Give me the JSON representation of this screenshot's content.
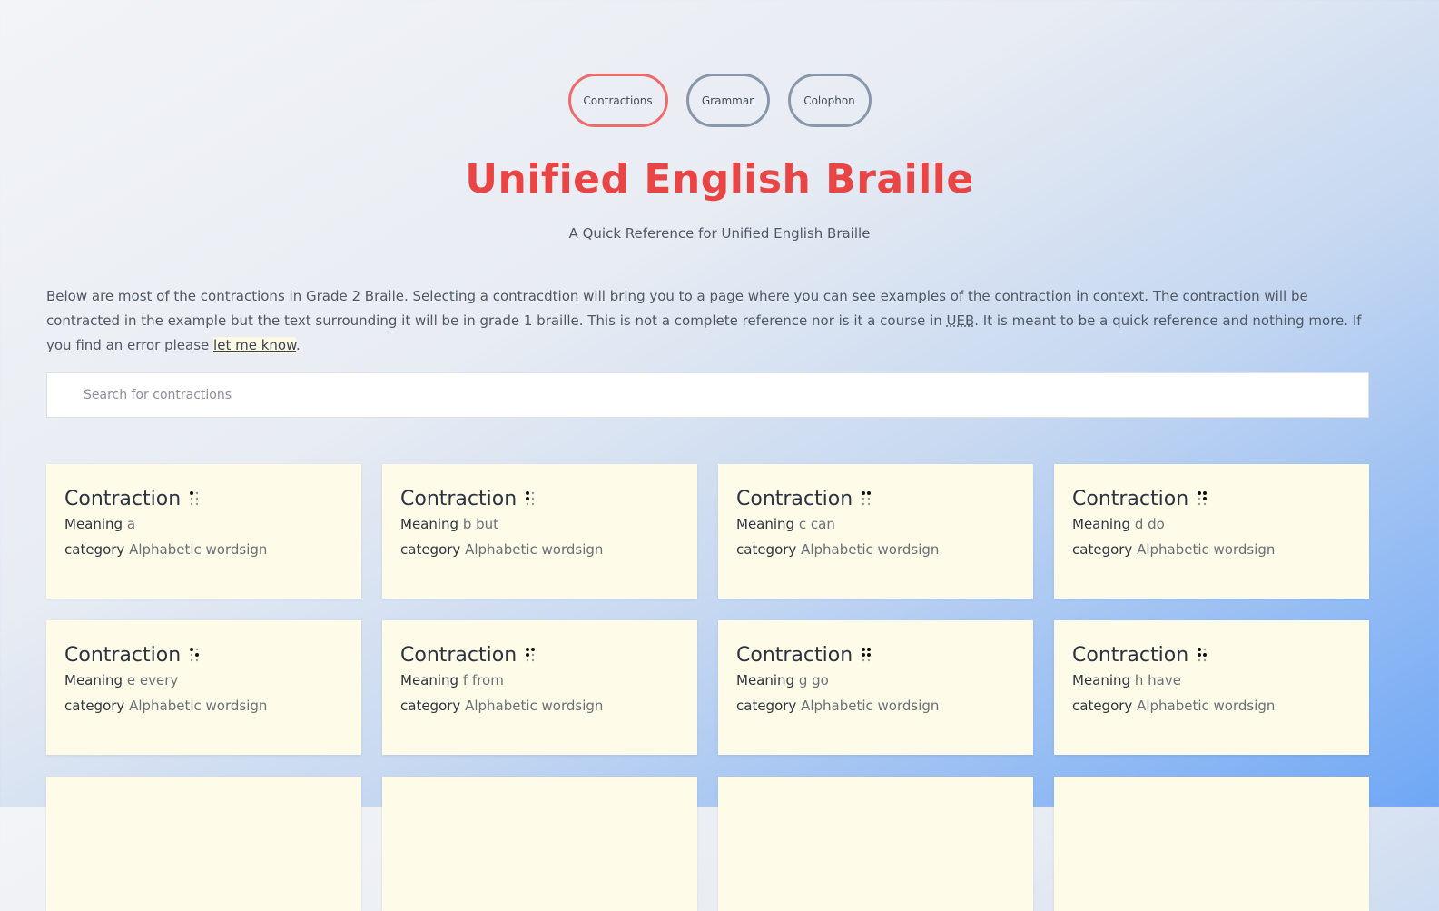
{
  "nav": [
    {
      "label": "Contractions",
      "active": true
    },
    {
      "label": "Grammar",
      "active": false
    },
    {
      "label": "Colophon",
      "active": false
    }
  ],
  "title": "Unified English Braille",
  "subtitle": "A Quick Reference for Unified English Braille",
  "intro": {
    "text1": "Below are most of the contractions in Grade 2 Braile. Selecting a contracdtion will bring you to a page where you can see examples of the contraction in context. The contraction will be contracted in the example but the text surrounding it will be in grade 1 braille. This is not a complete reference nor is it a course in ",
    "abbr": "UEB",
    "text2": ". It is meant to be a quick reference and nothing more. If you find an error please ",
    "link": "let me know",
    "text3": "."
  },
  "search": {
    "placeholder": "Search for contractions"
  },
  "card_labels": {
    "contraction": "Contraction",
    "meaning": "Meaning",
    "category": "category"
  },
  "cards": [
    {
      "braille": "⠁",
      "meaning": "a",
      "category": "Alphabetic wordsign"
    },
    {
      "braille": "⠃",
      "meaning": "b but",
      "category": "Alphabetic wordsign"
    },
    {
      "braille": "⠉",
      "meaning": "c can",
      "category": "Alphabetic wordsign"
    },
    {
      "braille": "⠙",
      "meaning": "d do",
      "category": "Alphabetic wordsign"
    },
    {
      "braille": "⠑",
      "meaning": "e every",
      "category": "Alphabetic wordsign"
    },
    {
      "braille": "⠋",
      "meaning": "f from",
      "category": "Alphabetic wordsign"
    },
    {
      "braille": "⠛",
      "meaning": "g go",
      "category": "Alphabetic wordsign"
    },
    {
      "braille": "⠓",
      "meaning": "h have",
      "category": "Alphabetic wordsign"
    },
    {
      "braille": "",
      "meaning": "",
      "category": ""
    },
    {
      "braille": "",
      "meaning": "",
      "category": ""
    },
    {
      "braille": "",
      "meaning": "",
      "category": ""
    },
    {
      "braille": "",
      "meaning": "",
      "category": ""
    }
  ]
}
